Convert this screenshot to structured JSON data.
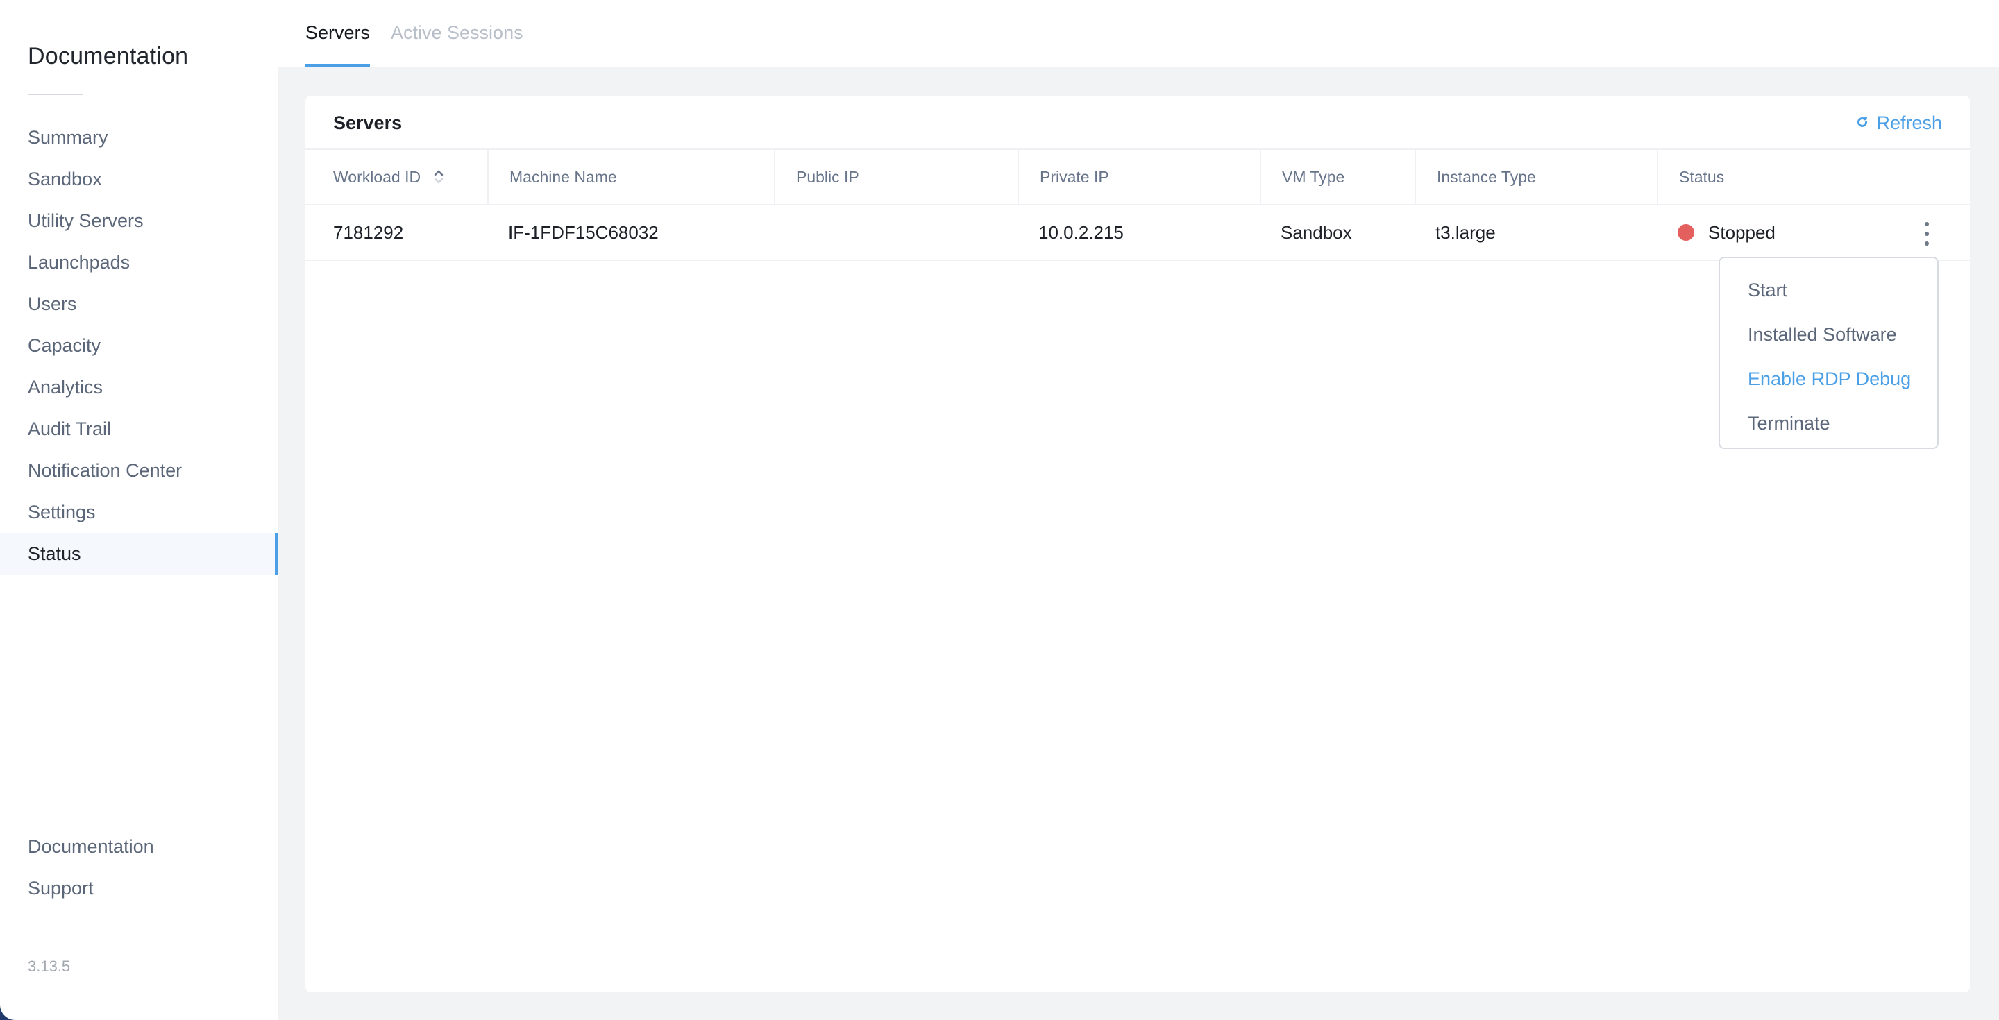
{
  "sidebar": {
    "title": "Documentation",
    "items": [
      {
        "label": "Summary",
        "active": false
      },
      {
        "label": "Sandbox",
        "active": false
      },
      {
        "label": "Utility Servers",
        "active": false
      },
      {
        "label": "Launchpads",
        "active": false
      },
      {
        "label": "Users",
        "active": false
      },
      {
        "label": "Capacity",
        "active": false
      },
      {
        "label": "Analytics",
        "active": false
      },
      {
        "label": "Audit Trail",
        "active": false
      },
      {
        "label": "Notification Center",
        "active": false
      },
      {
        "label": "Settings",
        "active": false
      },
      {
        "label": "Status",
        "active": true
      }
    ],
    "bottom_items": [
      {
        "label": "Documentation"
      },
      {
        "label": "Support"
      }
    ],
    "version": "3.13.5"
  },
  "tabs": [
    {
      "label": "Servers",
      "active": true
    },
    {
      "label": "Active Sessions",
      "active": false
    }
  ],
  "card": {
    "title": "Servers",
    "refresh_label": "Refresh",
    "refresh_icon": "refresh-icon"
  },
  "table": {
    "columns": [
      "Workload ID",
      "Machine Name",
      "Public IP",
      "Private IP",
      "VM Type",
      "Instance Type",
      "Status"
    ],
    "sort": {
      "column": "Workload ID",
      "direction": "ascending"
    },
    "rows": [
      {
        "workload_id": "7181292",
        "machine_name": "IF-1FDF15C68032",
        "public_ip": "",
        "private_ip": "10.0.2.215",
        "vm_type": "Sandbox",
        "instance_type": "t3.large",
        "status": "Stopped",
        "status_color": "#e3605e"
      }
    ]
  },
  "row_menu": {
    "icon": "kebab-menu-icon",
    "items": [
      {
        "label": "Start",
        "highlighted": false
      },
      {
        "label": "Installed Software",
        "highlighted": false
      },
      {
        "label": "Enable RDP Debug",
        "highlighted": true
      },
      {
        "label": "Terminate",
        "highlighted": false
      }
    ]
  },
  "colors": {
    "accent": "#4a9fe6",
    "stopped": "#e3605e",
    "background": "#f2f3f5",
    "nav_text": "#5b6779"
  }
}
